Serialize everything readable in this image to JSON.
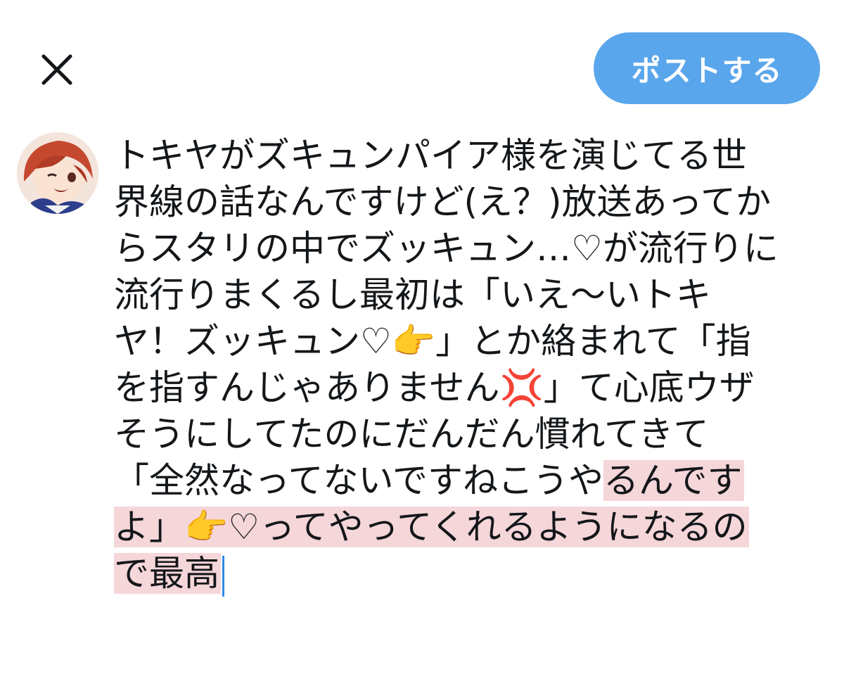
{
  "header": {
    "close_icon": "close-icon",
    "post_button_label": "ポストする",
    "post_button_color": "#5aa6ec"
  },
  "composer": {
    "avatar_icon": "user-avatar",
    "highlight_color": "#f5d6d9",
    "caret_color": "#2f8ae6",
    "lines": [
      {
        "plain": "トキヤがズキュンパイア様を演じてる世",
        "highlighted": ""
      },
      {
        "plain": "界線の話なんですけど(え？)放送あってか",
        "highlighted": ""
      },
      {
        "plain": "らスタリの中でズッキュン…♡が流行りに",
        "highlighted": ""
      },
      {
        "plain": "流行りまくるし最初は「いえ〜いトキ",
        "highlighted": ""
      },
      {
        "plain": "ヤ！ズッキュン♡👉」とか絡まれて「指",
        "highlighted": ""
      },
      {
        "plain": "を指すんじゃありません💢」て心底ウザ",
        "highlighted": ""
      },
      {
        "plain": "そうにしてたのにだんだん慣れてきて",
        "highlighted": ""
      },
      {
        "plain": "「全然なってないですねこうや",
        "highlighted": "るんです"
      },
      {
        "plain": "",
        "highlighted": "よ」👉♡ってやってくれるようになるの"
      },
      {
        "plain": "",
        "highlighted": "で最高"
      }
    ]
  }
}
